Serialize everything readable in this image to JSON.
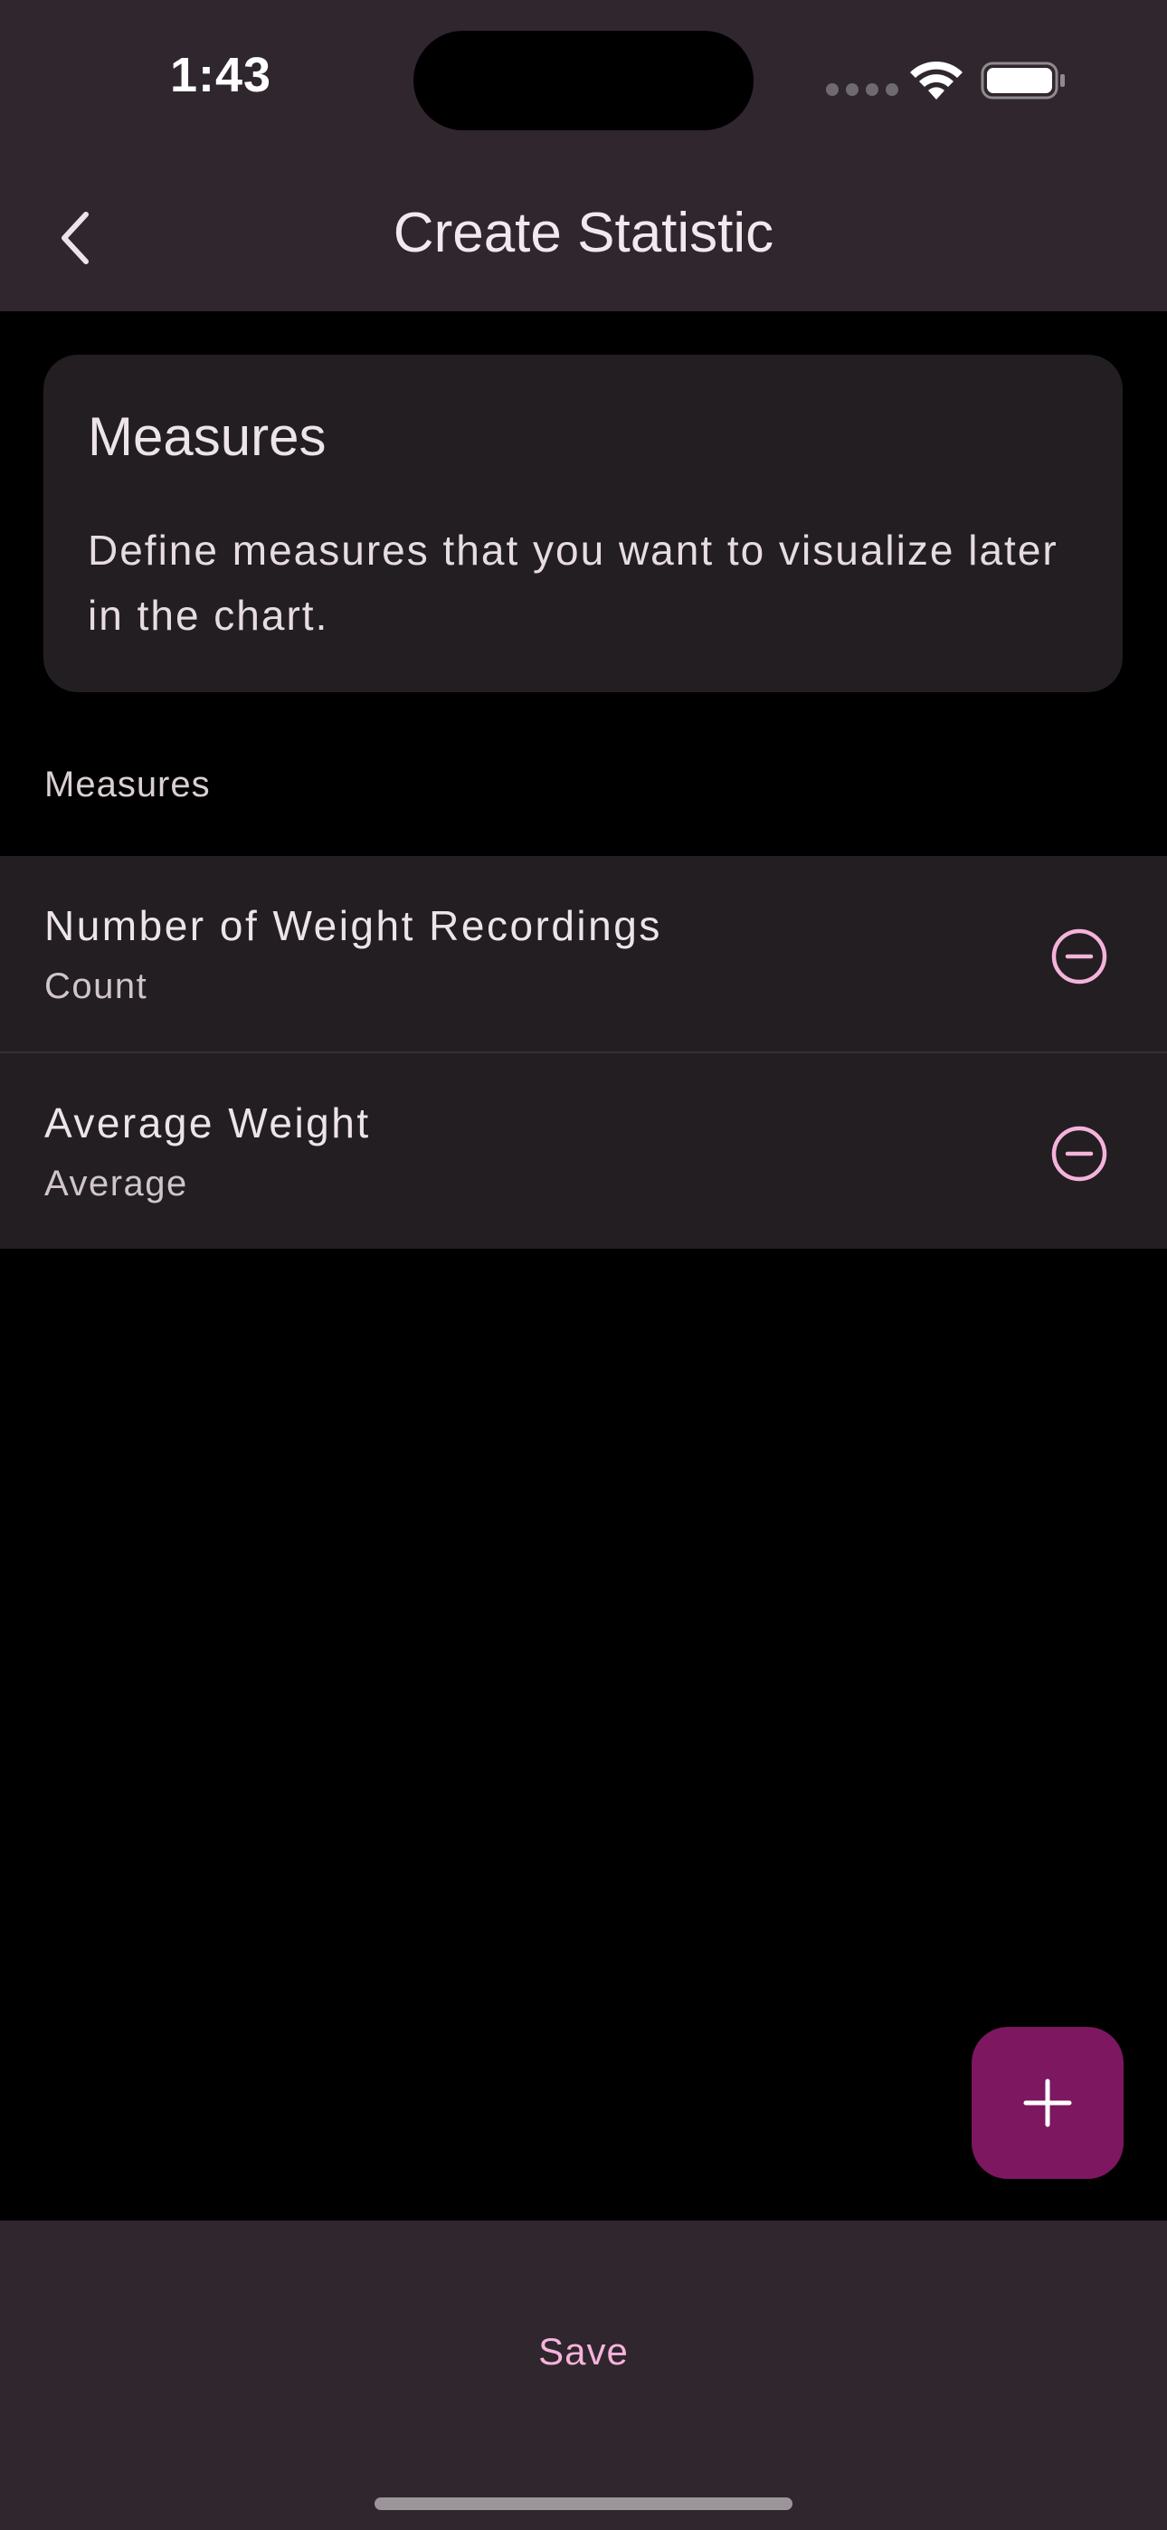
{
  "status_bar": {
    "time": "1:43",
    "wifi_icon": "wifi-icon",
    "battery_icon": "battery-icon"
  },
  "app_bar": {
    "back_icon": "chevron-left-icon",
    "title": "Create Statistic"
  },
  "info_card": {
    "title": "Measures",
    "description": "Define measures that you want to visualize later in the chart."
  },
  "section": {
    "label": "Measures"
  },
  "measures": [
    {
      "title": "Number of Weight Recordings",
      "subtitle": "Count",
      "action_icon": "remove-circle-icon"
    },
    {
      "title": "Average Weight",
      "subtitle": "Average",
      "action_icon": "remove-circle-icon"
    }
  ],
  "fab": {
    "icon": "plus-icon"
  },
  "bottom_bar": {
    "save_label": "Save"
  },
  "colors": {
    "background": "#000000",
    "surface_bar": "#30262E",
    "surface_card": "#221E21",
    "accent": "#F5B3DB",
    "fab": "#7C1760"
  }
}
